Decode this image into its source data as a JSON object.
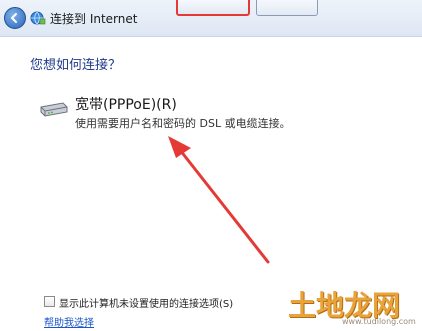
{
  "window": {
    "title": "连接到 Internet",
    "top_buttons": [
      "",
      ""
    ]
  },
  "main": {
    "heading": "您想如何连接？",
    "option": {
      "title": "宽带(PPPoE)(R)",
      "description": "使用需要用户名和密码的 DSL 或电缆连接。",
      "icon": "modem-icon"
    },
    "show_options_checkbox": {
      "label": "显示此计算机未设置使用的连接选项(S)",
      "checked": false
    },
    "help_link": "帮助我选择"
  },
  "watermark": {
    "text": "土地龙网",
    "subtext": "www.tudilong.com"
  },
  "colors": {
    "heading": "#1e3b8a",
    "link": "#1a56c9",
    "annotation_arrow": "#e53935",
    "watermark": "#e8a33a"
  }
}
